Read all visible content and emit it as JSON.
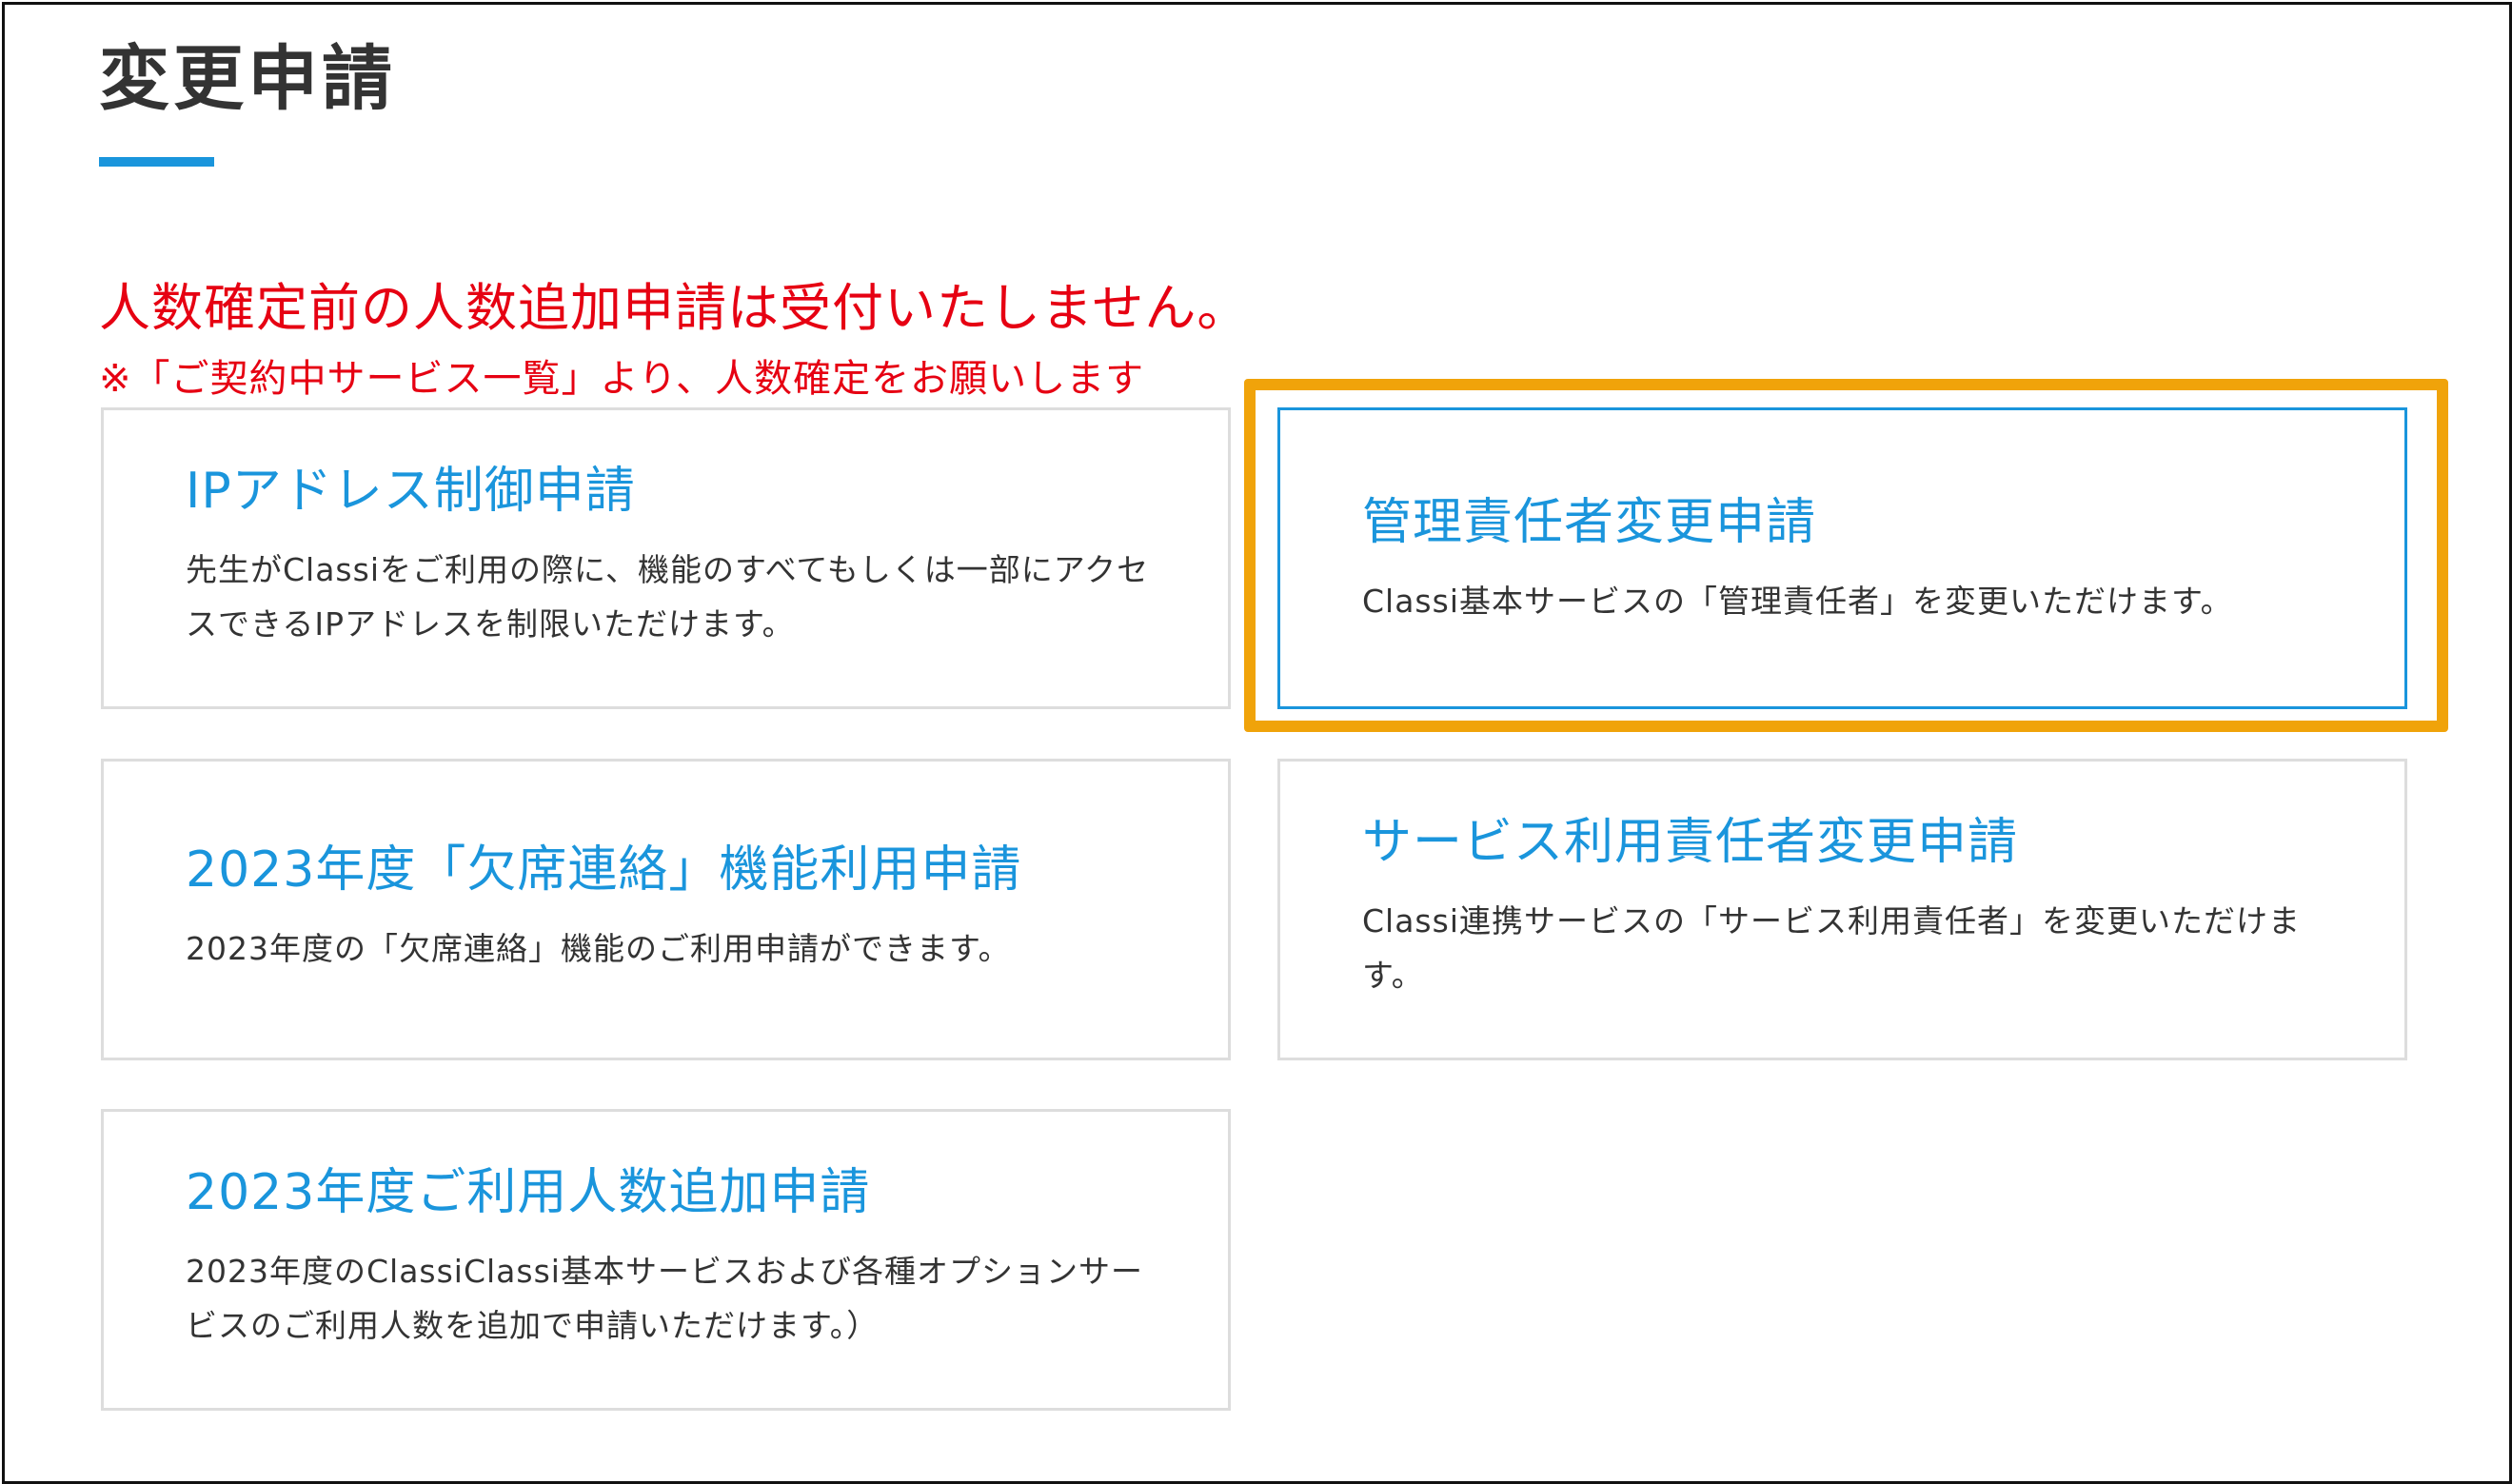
{
  "page": {
    "title": "変更申請"
  },
  "notice": {
    "main": "人数確定前の人数追加申請は受付いたしません。",
    "sub": "※「ご契約中サービス一覧」より、人数確定をお願いします"
  },
  "cards": [
    {
      "title": "IPアドレス制御申請",
      "description": "先生がClassiをご利用の際に、機能のすべてもしくは一部にアクセスできるIPアドレスを制限いただけます。"
    },
    {
      "title": "管理責任者変更申請",
      "description": "Classi基本サービスの「管理責任者」を変更いただけます。",
      "selected": true
    },
    {
      "title": "2023年度「欠席連絡」機能利用申請",
      "description": "2023年度の「欠席連絡」機能のご利用申請ができます。"
    },
    {
      "title": "サービス利用責任者変更申請",
      "description": "Classi連携サービスの「サービス利用責任者」を変更いただけます。"
    },
    {
      "title": "2023年度ご利用人数追加申請",
      "description": "2023年度のClassiClassi基本サービスおよび各種オプションサービスのご利用人数を追加で申請いただけます。）"
    }
  ],
  "colors": {
    "accent": "#1a95dc",
    "notice": "#e60012",
    "highlight": "#f0a30a",
    "text": "#333333"
  }
}
